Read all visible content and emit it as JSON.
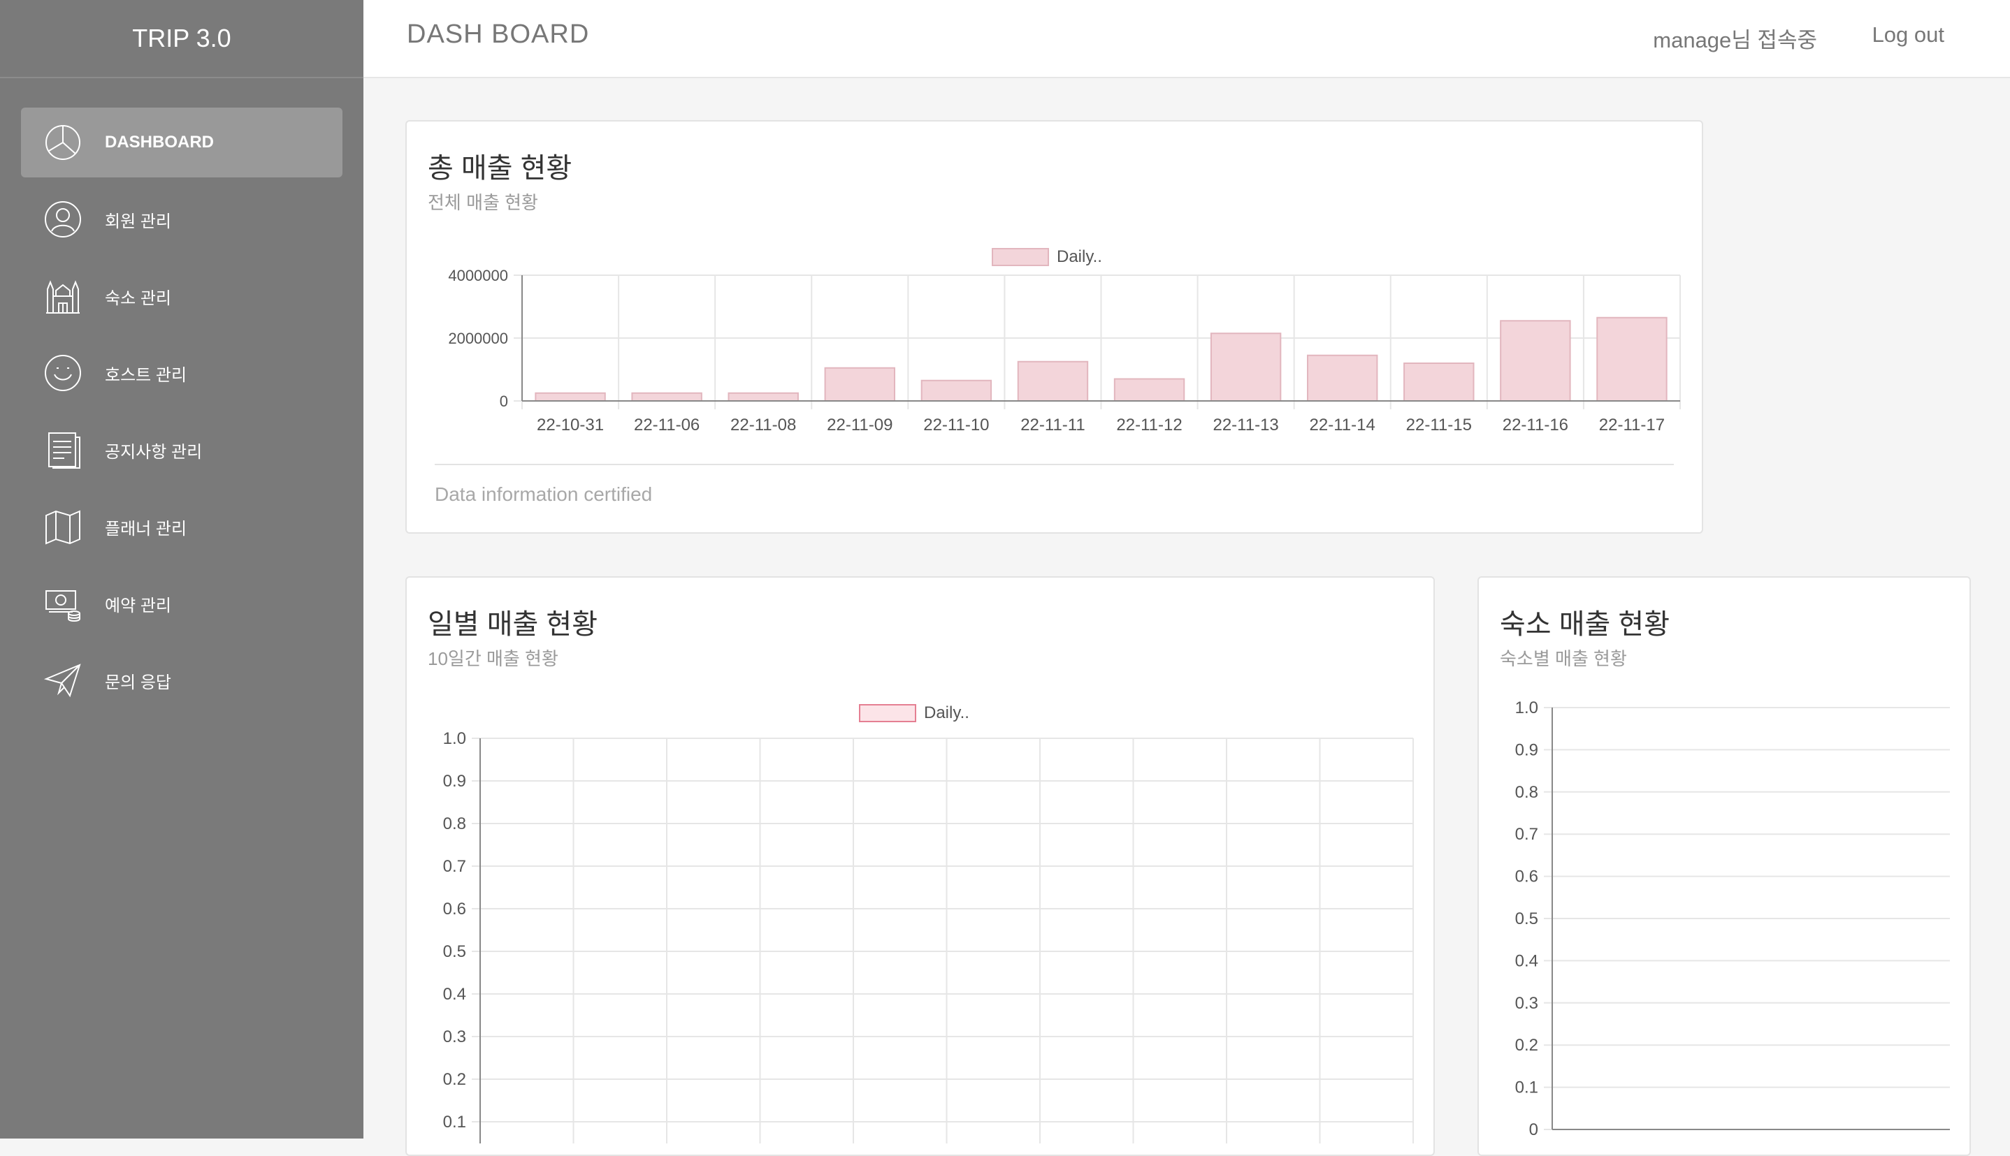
{
  "app": {
    "brand": "TRIP 3.0"
  },
  "header": {
    "title": "DASH BOARD",
    "user_status": "manage님 접속중",
    "logout": "Log out"
  },
  "sidebar": {
    "items": [
      {
        "label": "DASHBOARD",
        "icon": "pie-chart-icon",
        "active": true
      },
      {
        "label": "회원 관리",
        "icon": "user-icon"
      },
      {
        "label": "숙소 관리",
        "icon": "building-icon"
      },
      {
        "label": "호스트 관리",
        "icon": "smile-icon"
      },
      {
        "label": "공지사항 관리",
        "icon": "document-icon"
      },
      {
        "label": "플래너 관리",
        "icon": "map-icon"
      },
      {
        "label": "예약 관리",
        "icon": "money-icon"
      },
      {
        "label": "문의 응답",
        "icon": "paper-plane-icon"
      }
    ]
  },
  "cards": {
    "total": {
      "title": "총 매출 현황",
      "subtitle": "전체 매출 현황",
      "footer": "Data information certified"
    },
    "daily": {
      "title": "일별 매출 현황",
      "subtitle": "10일간 매출 현황"
    },
    "lodging": {
      "title": "숙소 매출 현황",
      "subtitle": "숙소별 매출 현황"
    }
  },
  "colors": {
    "bar_fill": "#f3d5da",
    "bar_border": "#e2b6be",
    "legend_border_daily": "#e57f92",
    "grid": "#e6e6e6",
    "sidebar": "#7a7a7a"
  },
  "chart_data": [
    {
      "type": "bar",
      "legend": "Daily..",
      "categories": [
        "22-10-31",
        "22-11-06",
        "22-11-08",
        "22-11-09",
        "22-11-10",
        "22-11-11",
        "22-11-12",
        "22-11-13",
        "22-11-14",
        "22-11-15",
        "22-11-16",
        "22-11-17"
      ],
      "values": [
        250000,
        250000,
        250000,
        1050000,
        650000,
        1250000,
        700000,
        2150000,
        1450000,
        1200000,
        2550000,
        2650000
      ],
      "yticks": [
        "0",
        "2000000",
        "4000000"
      ],
      "ylim": [
        0,
        4000000
      ],
      "grid": true,
      "legend_position": "top"
    },
    {
      "type": "bar",
      "legend": "Daily..",
      "categories": [],
      "values": [],
      "yticks": [
        "0.1",
        "0.2",
        "0.3",
        "0.4",
        "0.5",
        "0.6",
        "0.7",
        "0.8",
        "0.9",
        "1.0"
      ],
      "ylim": [
        0,
        1.0
      ],
      "grid": true,
      "legend_position": "top"
    },
    {
      "type": "bar",
      "categories": [],
      "values": [],
      "yticks": [
        "0",
        "0.1",
        "0.2",
        "0.3",
        "0.4",
        "0.5",
        "0.6",
        "0.7",
        "0.8",
        "0.9",
        "1.0"
      ],
      "ylim": [
        0,
        1.0
      ],
      "grid": true
    }
  ]
}
